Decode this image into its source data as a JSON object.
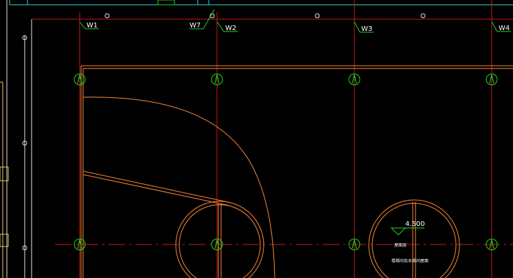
{
  "window": {
    "title": ""
  },
  "colors": {
    "background": "#000000",
    "grid_line": "#d01818",
    "wall_line": "#ff8a3c",
    "marker": "#22dd22",
    "annotation": "#22dd22",
    "text": "#ffffff",
    "cyan": "#30e0e0",
    "white_line": "#e8e8e8",
    "yellow": "#e8d060"
  },
  "axis_labels": {
    "w1": "W1",
    "w7": "W7",
    "w2": "W2",
    "w3": "W3",
    "w4": "W4"
  },
  "annotations": {
    "elevation": "4.500",
    "note_line1": "屋面层",
    "note_line2": "楼梯间及水箱间屋面"
  }
}
